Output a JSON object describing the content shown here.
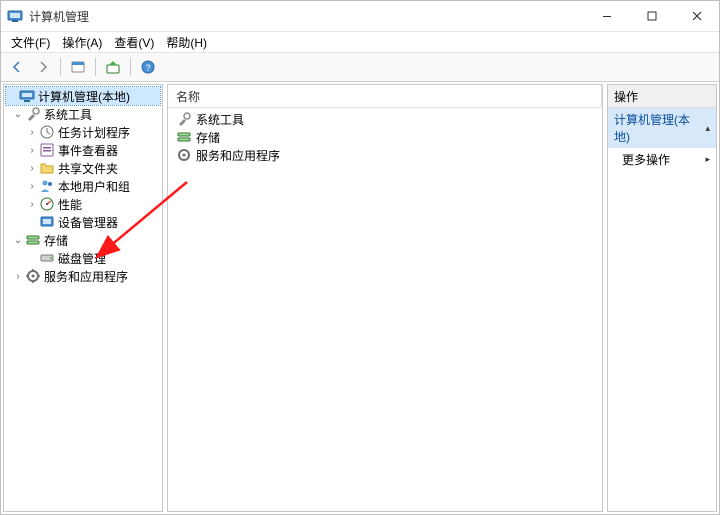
{
  "window": {
    "title": "计算机管理"
  },
  "menubar": {
    "file": "文件(F)",
    "action": "操作(A)",
    "view": "查看(V)",
    "help": "帮助(H)"
  },
  "tree": {
    "root": "计算机管理(本地)",
    "system_tools": "系统工具",
    "task_scheduler": "任务计划程序",
    "event_viewer": "事件查看器",
    "shared_folders": "共享文件夹",
    "local_users": "本地用户和组",
    "performance": "性能",
    "device_manager": "设备管理器",
    "storage": "存储",
    "disk_management": "磁盘管理",
    "services_apps": "服务和应用程序"
  },
  "list": {
    "header_name": "名称",
    "items": [
      "系统工具",
      "存储",
      "服务和应用程序"
    ]
  },
  "actions": {
    "header": "操作",
    "group1_title": "计算机管理(本地)",
    "more_actions": "更多操作"
  }
}
